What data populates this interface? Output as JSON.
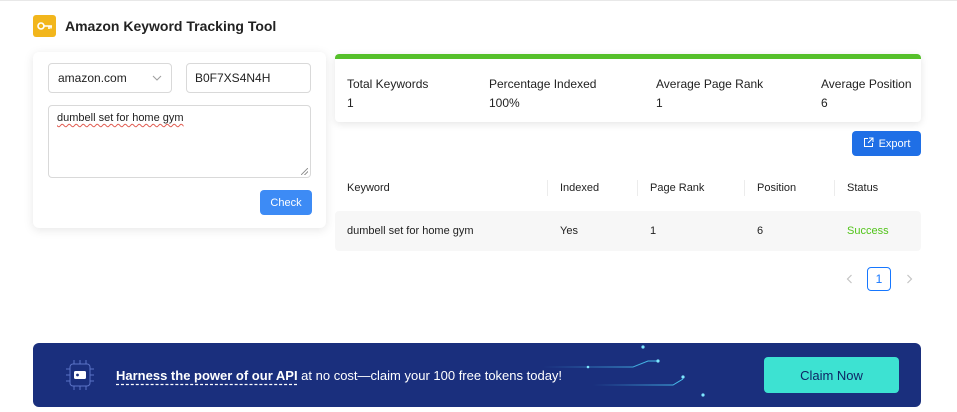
{
  "app": {
    "title": "Amazon Keyword Tracking Tool",
    "logo_icon": "key-icon",
    "logo_color": "#f2b61c"
  },
  "form": {
    "marketplace": "amazon.com",
    "asin": "B0F7XS4N4H",
    "keywords": "dumbell set for home gym",
    "check_label": "Check"
  },
  "stats": {
    "progress_percent": 100,
    "items": [
      {
        "label": "Total Keywords",
        "value": "1"
      },
      {
        "label": "Percentage Indexed",
        "value": "100%"
      },
      {
        "label": "Average Page Rank",
        "value": "1"
      },
      {
        "label": "Average Position",
        "value": "6"
      }
    ]
  },
  "export_label": "Export",
  "table": {
    "columns": [
      "Keyword",
      "Indexed",
      "Page Rank",
      "Position",
      "Status"
    ],
    "rows": [
      [
        "dumbell set for home gym",
        "Yes",
        "1",
        "6",
        "Success"
      ]
    ]
  },
  "pagination": {
    "current_page": "1",
    "prev_icon": "chevron-left-icon",
    "next_icon": "chevron-right-icon"
  },
  "banner": {
    "headline": "Harness the power of our API",
    "rest": " at no cost—claim your 100 free tokens today!",
    "cta": "Claim Now",
    "icon": "api-chip-icon"
  },
  "colors": {
    "accent": "#1f6fe6",
    "success": "#52c41a",
    "progress": "#56c02b",
    "banner_bg": "#1a2f7d",
    "cta_bg": "#3de2d2"
  }
}
